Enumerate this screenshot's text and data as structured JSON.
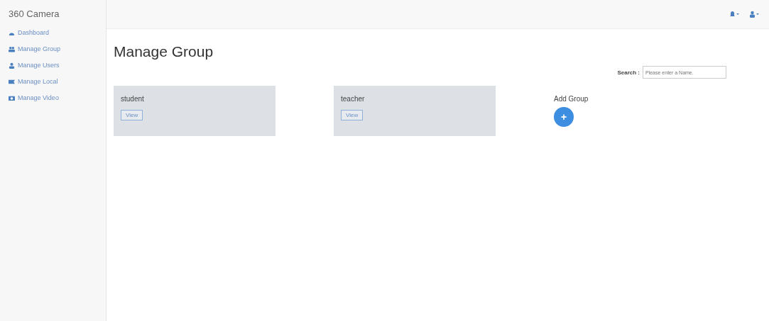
{
  "brand": "360 Camera",
  "sidebar": {
    "items": [
      {
        "label": "Dashboard"
      },
      {
        "label": "Manage Group"
      },
      {
        "label": "Manage Users"
      },
      {
        "label": "Manage Local"
      },
      {
        "label": "Manage Video"
      }
    ]
  },
  "page_title": "Manage Group",
  "search": {
    "label": "Search :",
    "placeholder": "Please enter a Name."
  },
  "groups": [
    {
      "name": "student",
      "button": "View"
    },
    {
      "name": "teacher",
      "button": "View"
    }
  ],
  "add_group": {
    "label": "Add Group",
    "button": "+"
  }
}
